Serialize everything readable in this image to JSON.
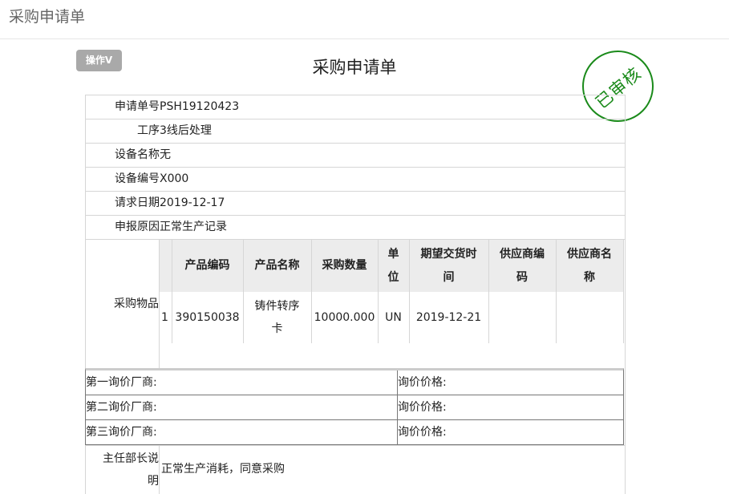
{
  "header": {
    "title": "采购申请单"
  },
  "toolbar": {
    "op_label": "操作V"
  },
  "form": {
    "title": "采购申请单",
    "stamp": "已审核",
    "fields": [
      {
        "label": "申请单号",
        "value": "PSH19120423"
      },
      {
        "label": "工序",
        "value": "3线后处理"
      },
      {
        "label": "设备名称",
        "value": "无"
      },
      {
        "label": "设备编号",
        "value": "X000"
      },
      {
        "label": "请求日期",
        "value": "2019-12-17"
      },
      {
        "label": "申报原因",
        "value": "正常生产记录"
      }
    ],
    "goods": {
      "label": "采购物品",
      "columns": [
        "",
        "产品编码",
        "产品名称",
        "采购数量",
        "单\n位",
        "期望交货时\n间",
        "供应商编\n码",
        "供应商名\n称"
      ],
      "rows": [
        {
          "idx": "1",
          "code": "390150038",
          "name": "铸件转序\n卡",
          "qty": "10000.000",
          "unit": "UN",
          "date": "2019-12-21",
          "supplier_code": "",
          "supplier_name": ""
        }
      ]
    },
    "inquiries": [
      {
        "vendor": "第一询价厂商:",
        "price": "询价价格:"
      },
      {
        "vendor": "第二询价厂商:",
        "price": "询价价格:"
      },
      {
        "vendor": "第三询价厂商:",
        "price": "询价价格:"
      }
    ],
    "supervisor": {
      "label": "主任部长说明",
      "value": "正常生产消耗，同意采购"
    }
  }
}
